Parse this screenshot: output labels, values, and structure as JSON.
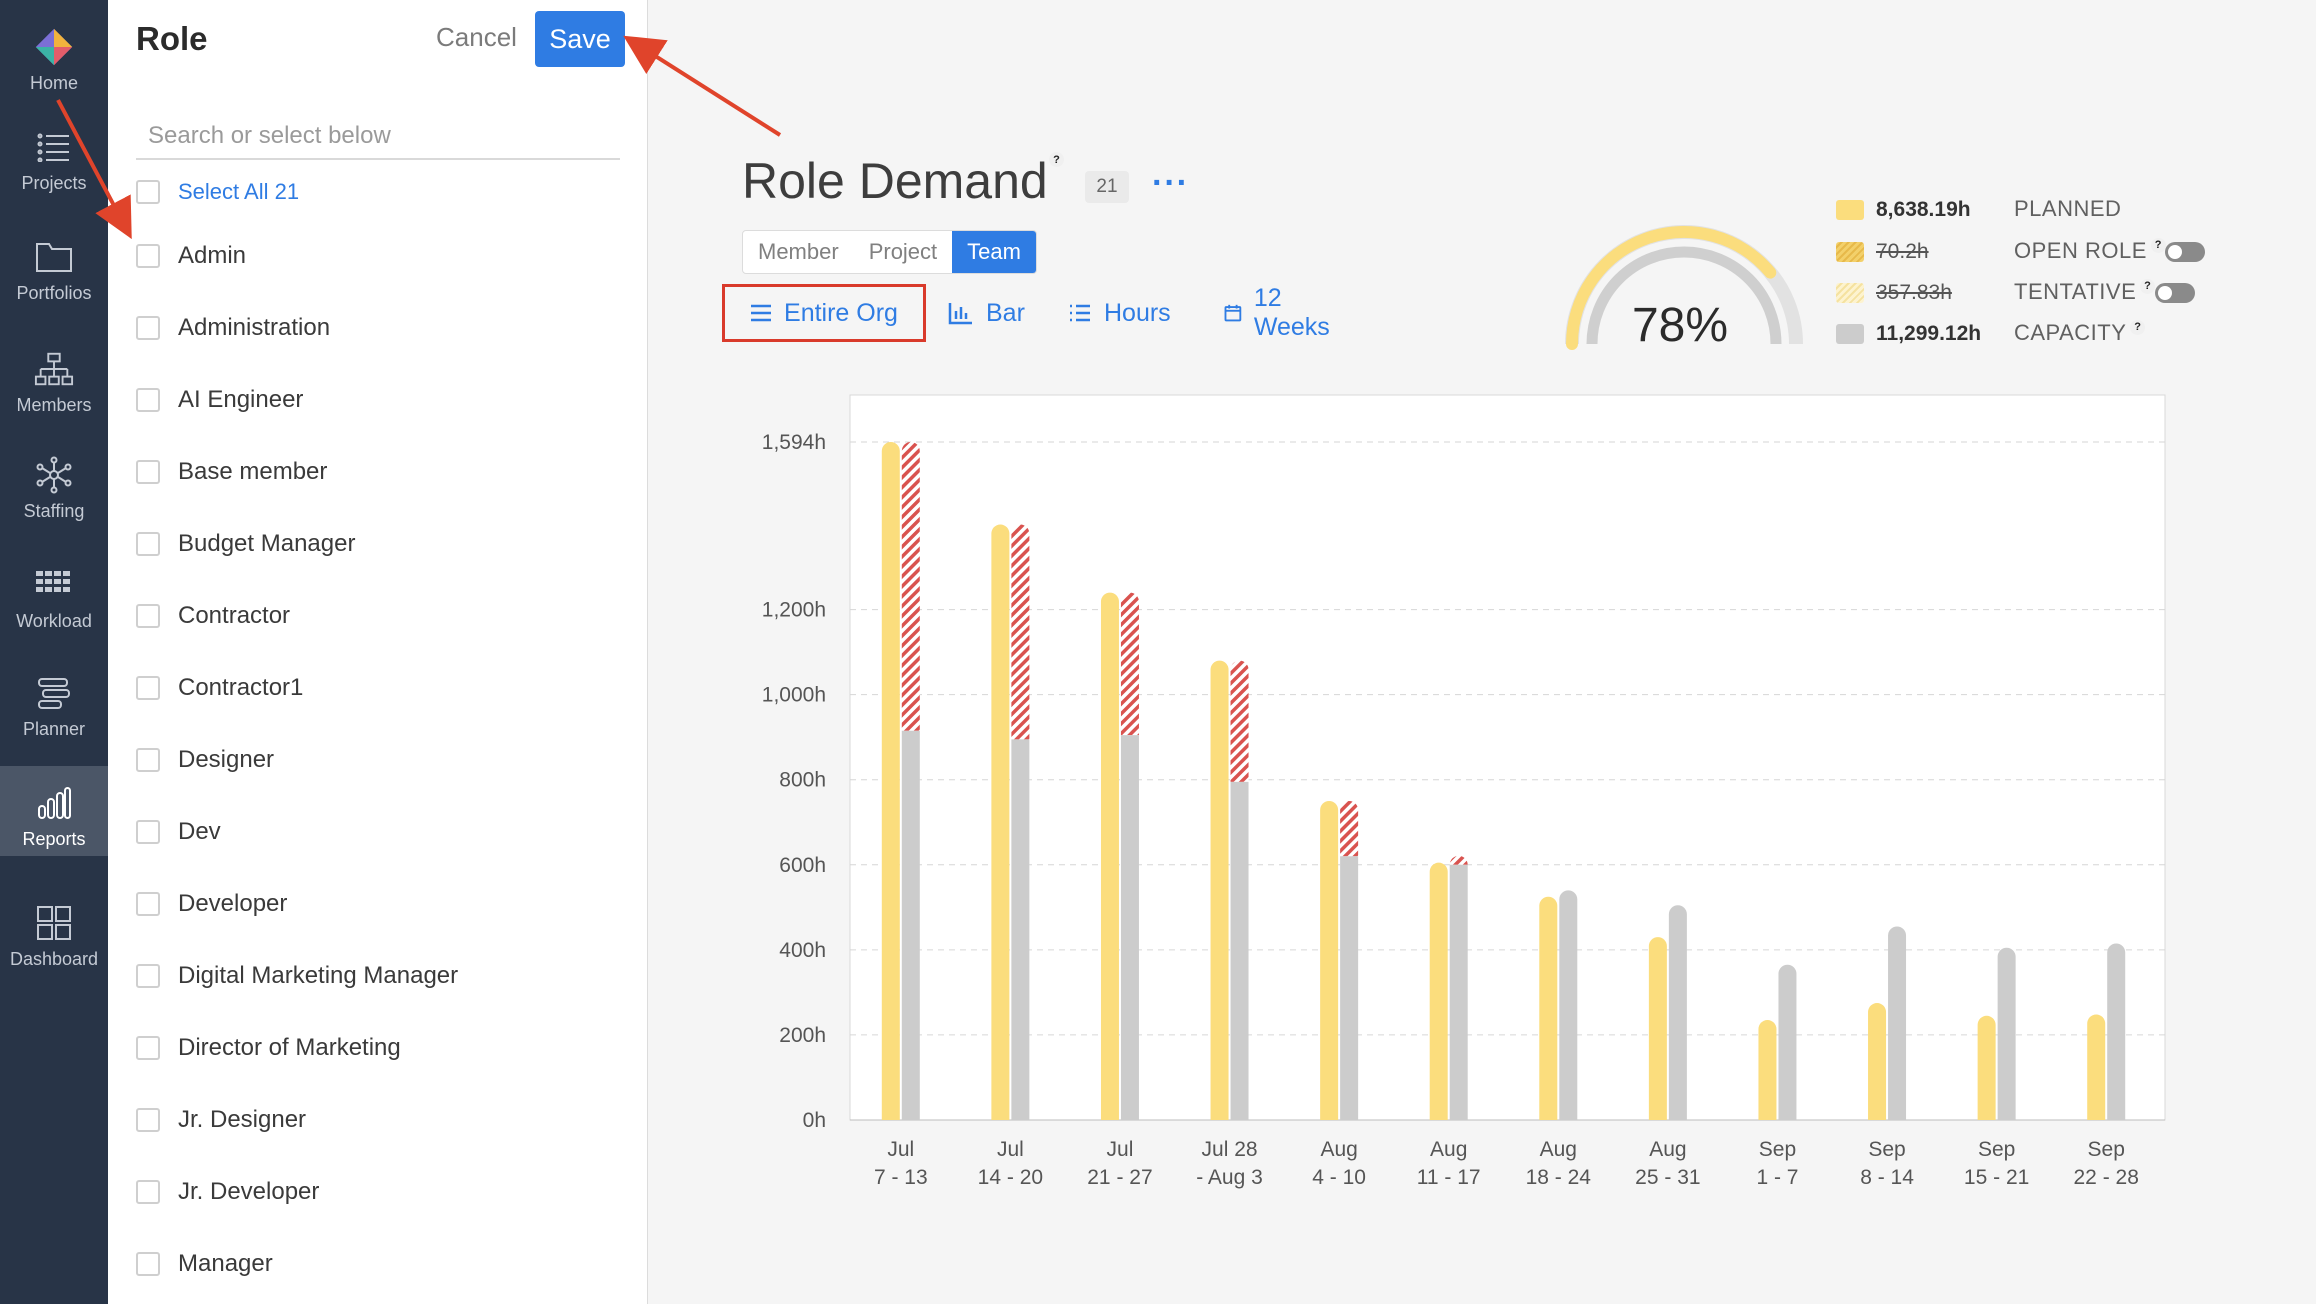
{
  "nav": {
    "items": [
      {
        "label": "Home",
        "icon": "logo-icon"
      },
      {
        "label": "Projects",
        "icon": "list-icon"
      },
      {
        "label": "Portfolios",
        "icon": "folder-icon"
      },
      {
        "label": "Members",
        "icon": "org-chart-icon"
      },
      {
        "label": "Staffing",
        "icon": "network-icon"
      },
      {
        "label": "Workload",
        "icon": "grid-icon"
      },
      {
        "label": "Planner",
        "icon": "planner-icon"
      },
      {
        "label": "Reports",
        "icon": "bar-chart-icon",
        "active": true
      },
      {
        "label": "Dashboard",
        "icon": "dashboard-icon"
      }
    ]
  },
  "panel": {
    "title": "Role",
    "cancel_label": "Cancel",
    "save_label": "Save",
    "search_placeholder": "Search or select below",
    "select_all_label": "Select All 21",
    "roles": [
      "Admin",
      "Administration",
      "AI Engineer",
      "Base member",
      "Budget Manager",
      "Contractor",
      "Contractor1",
      "Designer",
      "Dev",
      "Developer",
      "Digital Marketing Manager",
      "Director of Marketing",
      "Jr. Designer",
      "Jr. Developer",
      "Manager"
    ]
  },
  "report": {
    "title": "Role Demand",
    "help": "?",
    "count": "21",
    "more": "···",
    "tabs": [
      {
        "label": "Member",
        "active": false
      },
      {
        "label": "Project",
        "active": false
      },
      {
        "label": "Team",
        "active": true
      }
    ],
    "controls": {
      "scope": "Entire Org",
      "chart_type": "Bar",
      "unit": "Hours",
      "range": "12 Weeks"
    }
  },
  "summary": {
    "gauge_percent": "78%",
    "gauge_fraction": 0.78,
    "legend": [
      {
        "value": "8,638.19h",
        "name": "PLANNED",
        "color": "#fbdd7d",
        "struck": false
      },
      {
        "value": "70.2h",
        "name": "OPEN ROLE",
        "color": "#f3d06a",
        "struck": true,
        "help": "?",
        "toggle": true
      },
      {
        "value": "357.83h",
        "name": "TENTATIVE",
        "color": "#fdf3cf",
        "struck": true,
        "help": "?",
        "toggle": true
      },
      {
        "value": "11,299.12h",
        "name": "CAPACITY",
        "color": "#cccccc",
        "struck": false,
        "help": "?"
      }
    ]
  },
  "colors": {
    "accent": "#2f7ce3",
    "planned": "#fbdd7d",
    "capacity": "#cccccc",
    "overbooked": "#d9534f",
    "annotation": "#e0442b",
    "nav_bg": "#283447"
  },
  "chart_data": {
    "type": "bar",
    "ylim": [
      0,
      1594
    ],
    "yticks": [
      0,
      200,
      400,
      600,
      800,
      1000,
      1200,
      1594
    ],
    "ytick_labels": [
      "0h",
      "200h",
      "400h",
      "600h",
      "800h",
      "1,000h",
      "1,200h",
      "1,594h"
    ],
    "categories": [
      [
        "Jul",
        "7 - 13"
      ],
      [
        "Jul",
        "14 - 20"
      ],
      [
        "Jul",
        "21 - 27"
      ],
      [
        "Jul 28",
        "- Aug 3"
      ],
      [
        "Aug",
        "4 - 10"
      ],
      [
        "Aug",
        "11 - 17"
      ],
      [
        "Aug",
        "18 - 24"
      ],
      [
        "Aug",
        "25 - 31"
      ],
      [
        "Sep",
        "1 - 7"
      ],
      [
        "Sep",
        "8 - 14"
      ],
      [
        "Sep",
        "15 - 21"
      ],
      [
        "Sep",
        "22 - 28"
      ]
    ],
    "series": [
      {
        "values": [
          1594,
          1400,
          1240,
          1080,
          750,
          605,
          525,
          430,
          235,
          275,
          245,
          248
        ]
      },
      {
        "values": [
          915,
          895,
          905,
          795,
          620,
          600,
          540,
          505,
          365,
          455,
          405,
          415
        ]
      },
      {
        "values": [
          679,
          505,
          335,
          285,
          130,
          5,
          0,
          0,
          0,
          0,
          0,
          0
        ]
      }
    ]
  }
}
